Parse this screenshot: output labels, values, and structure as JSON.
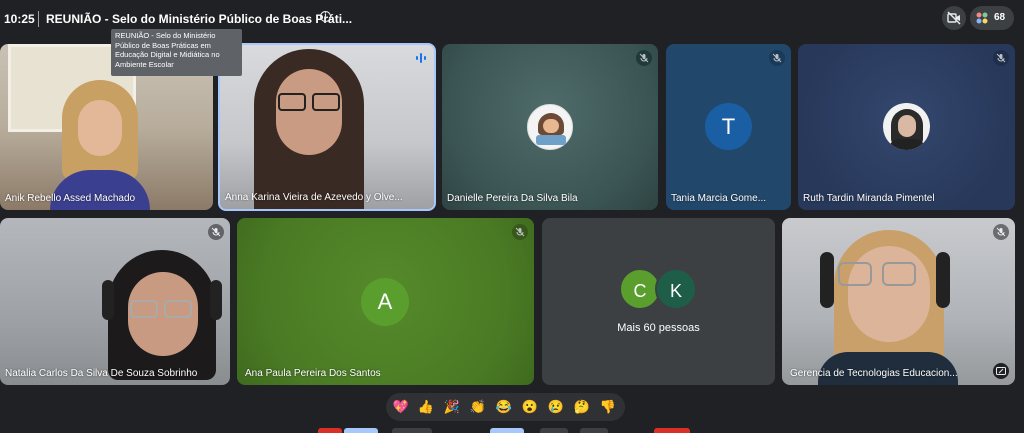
{
  "header": {
    "time": "10:25",
    "meeting_title": "REUNIÃO - Selo do Ministério Público de Boas Práti...",
    "participant_count": "68"
  },
  "tooltip": {
    "text": "REUNIÃO - Selo do Ministério Público de Boas Práticas em Educação Digital e Midiática no Ambiente Escolar"
  },
  "participants": [
    {
      "name": "Anik Rebello Assed Machado"
    },
    {
      "name": "Anna Karina Vieira de Azevedo y Olve..."
    },
    {
      "name": "Danielle Pereira Da Silva Bila"
    },
    {
      "name": "Tania Marcia Gome...",
      "initial": "T"
    },
    {
      "name": "Ruth Tardin Miranda Pimentel"
    },
    {
      "name": "Natalia Carlos Da Silva De Souza Sobrinho"
    },
    {
      "name": "Ana Paula Pereira Dos Santos",
      "initial": "A"
    },
    {
      "name": "Gerencia de Tecnologias Educacion..."
    }
  ],
  "more_tile": {
    "initials": [
      "C",
      "K"
    ],
    "label": "Mais 60 pessoas"
  },
  "reactions": [
    "💖",
    "👍",
    "🎉",
    "👏",
    "😂",
    "😮",
    "😢",
    "🤔",
    "👎"
  ],
  "colors": {
    "background": "#202124",
    "tile_teal": "#3d5a5a",
    "tile_blue": "#21476b",
    "tile_navy": "#2a3d60",
    "tile_green": "#4a7a24",
    "avatar_blue": "#1a5fa3",
    "avatar_green": "#5a9e2e",
    "avatar_c": "#5a9e2e",
    "avatar_k": "#1e5e48",
    "speaking_border": "#a8c7fa"
  }
}
